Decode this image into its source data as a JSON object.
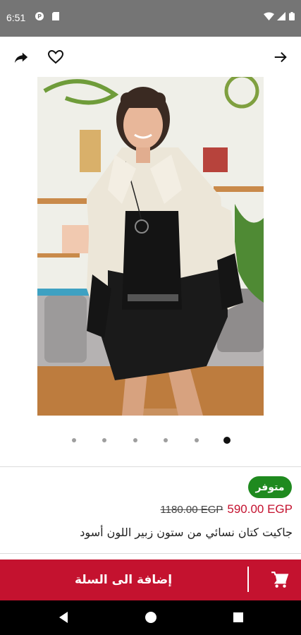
{
  "status_bar": {
    "time": "6:51",
    "left_icons": [
      "p-circle-icon",
      "sd-card-icon"
    ],
    "right_icons": [
      "wifi-icon",
      "signal-icon",
      "battery-icon"
    ]
  },
  "toolbar": {
    "share_icon": "share-arrow-icon",
    "favorite_icon": "heart-outline-icon",
    "back_icon": "arrow-right-icon"
  },
  "gallery": {
    "image_count": 6,
    "active_index": 5
  },
  "product": {
    "availability": "متوفر",
    "old_price": "1180.00 EGP",
    "price": "590.00 EGP",
    "title": "جاكيت كتان نسائي من ستون زبير  اللون أسود"
  },
  "cart_bar": {
    "add_to_cart_label": "إضافة الى السلة",
    "cart_icon": "shopping-cart-icon"
  },
  "colors": {
    "accent": "#c4122f",
    "badge_green": "#1f8a1f",
    "status_bar": "#757575"
  }
}
